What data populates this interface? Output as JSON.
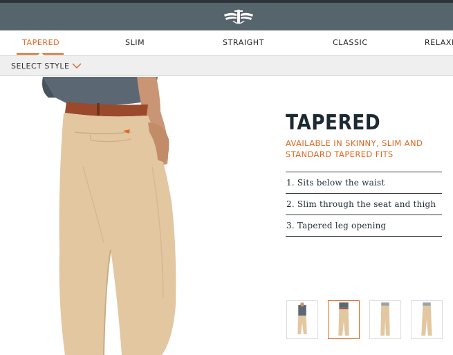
{
  "colors": {
    "accent": "#e0661f",
    "topbar": "#56646c",
    "text_dark": "#1d2a33"
  },
  "header": {
    "logo_icon": "dockers-wing-logo-icon"
  },
  "tabs": [
    {
      "label": "TAPERED",
      "active": true
    },
    {
      "label": "SLIM",
      "active": false
    },
    {
      "label": "STRAIGHT",
      "active": false
    },
    {
      "label": "CLASSIC",
      "active": false
    },
    {
      "label": "RELAXED",
      "active": false
    }
  ],
  "style_selector": {
    "label": "SELECT STYLE",
    "icon": "chevron-down-icon"
  },
  "product": {
    "title": "TAPERED",
    "subtitle": "AVAILABLE IN SKINNY, SLIM AND STANDARD TAPERED FITS",
    "features": [
      "1. Sits below the waist",
      "2. Slim through the seat and thigh",
      "3. Tapered leg opening"
    ]
  },
  "thumbnails": [
    {
      "view": "front-full",
      "selected": false
    },
    {
      "view": "back",
      "selected": true
    },
    {
      "view": "side",
      "selected": false
    },
    {
      "view": "side-alt",
      "selected": false
    }
  ]
}
